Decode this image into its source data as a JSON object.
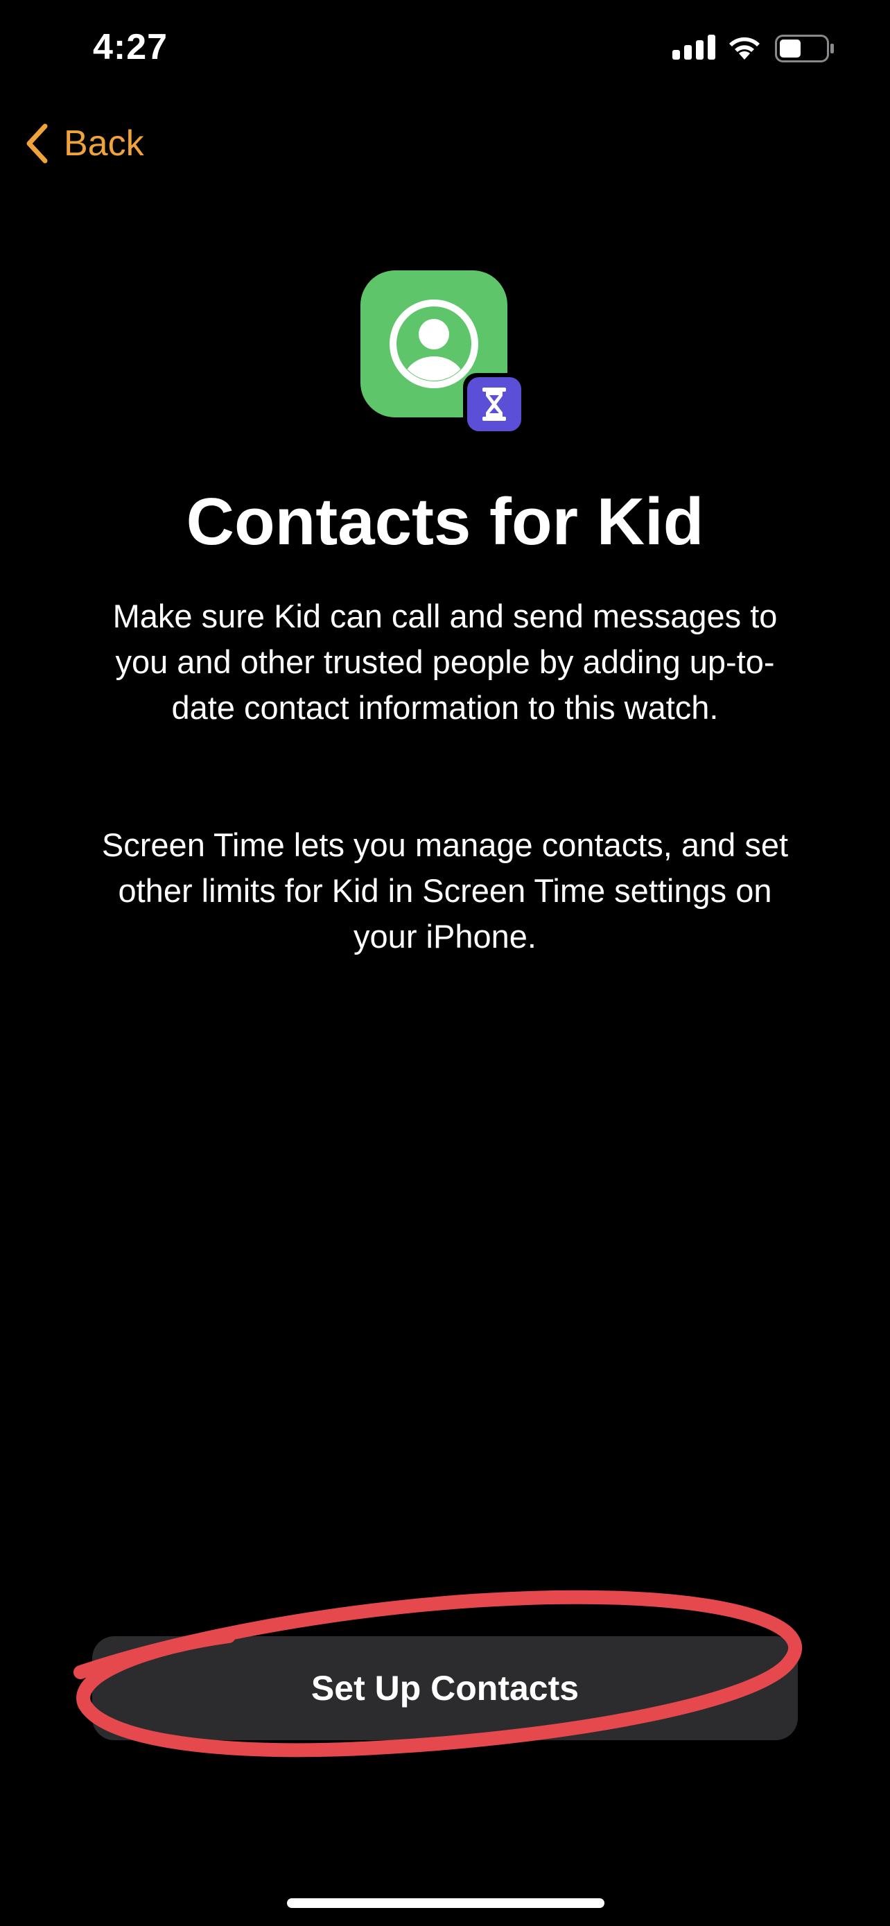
{
  "status_bar": {
    "time": "4:27"
  },
  "nav": {
    "back_label": "Back"
  },
  "content": {
    "title": "Contacts for Kid",
    "paragraph_1": "Make sure Kid can call and send messages to you and other trusted people by adding up-to-date contact information to this watch.",
    "paragraph_2": "Screen Time lets you manage contacts, and set other limits for Kid in Screen Time settings on your iPhone."
  },
  "actions": {
    "setup_label": "Set Up Contacts"
  },
  "icons": {
    "app_icon": "contacts-icon",
    "badge_icon": "screen-time-hourglass-icon",
    "back_icon": "chevron-left-icon"
  },
  "colors": {
    "background": "#000000",
    "accent": "#f0a33a",
    "contacts_green": "#5fc56a",
    "screen_time_purple": "#5a4fd6",
    "button_bg": "#2c2c2e",
    "annotation_red": "#e5484d"
  }
}
